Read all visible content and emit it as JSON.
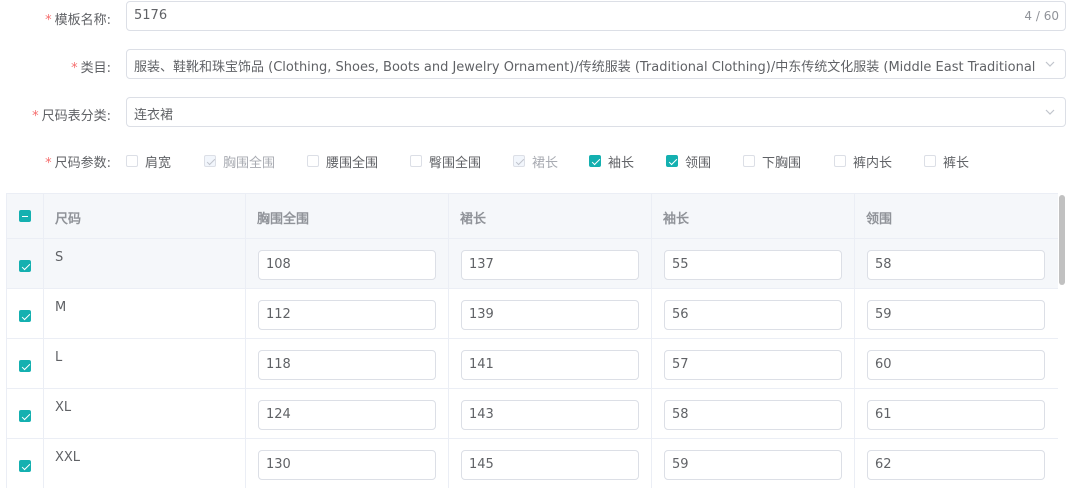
{
  "template_name": {
    "label": "模板名称:",
    "value": "5176",
    "count": "4 / 60"
  },
  "category": {
    "label": "类目:",
    "value": "服装、鞋靴和珠宝饰品 (Clothing, Shoes, Boots and Jewelry Ornament)/传统服装 (Traditional Clothing)/中东传统文化服装 (Middle East Traditional ..."
  },
  "size_chart_type": {
    "label": "尺码表分类:",
    "value": "连衣裙"
  },
  "size_params": {
    "label": "尺码参数:",
    "items": [
      {
        "label": "肩宽",
        "state": "unchecked"
      },
      {
        "label": "胸围全围",
        "state": "checked-disabled"
      },
      {
        "label": "腰围全围",
        "state": "unchecked"
      },
      {
        "label": "臀围全围",
        "state": "unchecked"
      },
      {
        "label": "裙长",
        "state": "checked-disabled"
      },
      {
        "label": "袖长",
        "state": "checked"
      },
      {
        "label": "领围",
        "state": "checked"
      },
      {
        "label": "下胸围",
        "state": "unchecked"
      },
      {
        "label": "裤内长",
        "state": "unchecked"
      },
      {
        "label": "裤长",
        "state": "unchecked"
      }
    ]
  },
  "table": {
    "headers": [
      "尺码",
      "胸围全围",
      "裙长",
      "袖长",
      "领围"
    ],
    "rows": [
      {
        "size": "S",
        "values": [
          "108",
          "137",
          "55",
          "58"
        ]
      },
      {
        "size": "M",
        "values": [
          "112",
          "139",
          "56",
          "59"
        ]
      },
      {
        "size": "L",
        "values": [
          "118",
          "141",
          "57",
          "60"
        ]
      },
      {
        "size": "XL",
        "values": [
          "124",
          "143",
          "58",
          "61"
        ]
      },
      {
        "size": "XXL",
        "values": [
          "130",
          "145",
          "59",
          "62"
        ]
      }
    ]
  },
  "colors": {
    "accent": "#14b0b0",
    "required": "#f56c6c"
  }
}
